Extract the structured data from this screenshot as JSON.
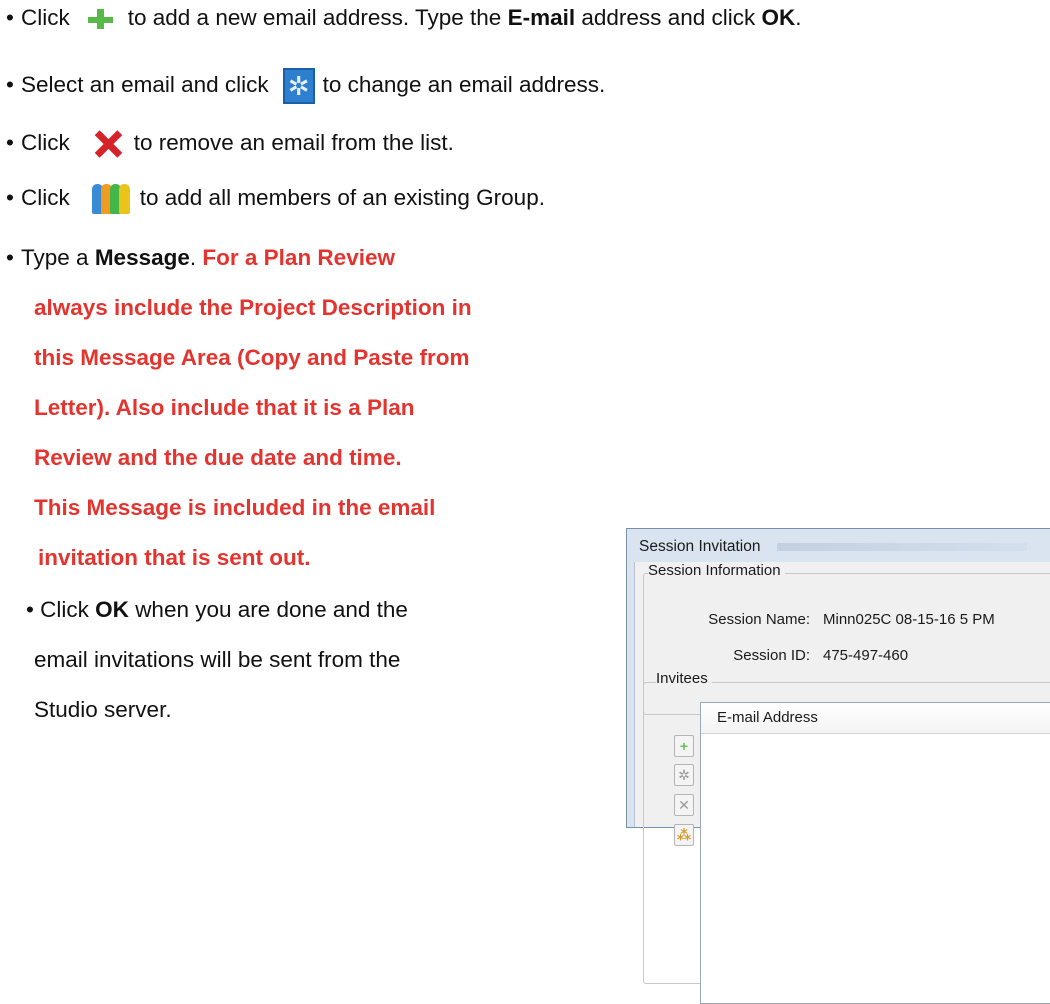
{
  "instructions": {
    "bullet": "•",
    "line1": {
      "text_before": "Click",
      "text_mid": "to add a new email address. Type the",
      "bold1": "E-mail",
      "text_mid2": "address and click",
      "bold2": "OK",
      "text_end": "."
    },
    "line2": {
      "text_before": "Select an email and click",
      "text_after": "to change an email address."
    },
    "line3": {
      "text_before": "Click",
      "text_after": "to remove an email from the list."
    },
    "line4": {
      "text_before": "Click",
      "text_after": "to add all members of an existing Group."
    },
    "line5": {
      "text_before": "Type a",
      "bold": "Message",
      "text_mid": ".",
      "red_first": "For a Plan Review"
    },
    "red_lines": [
      "always include the Project Description in",
      "this Message Area (Copy and Paste from",
      "Letter). Also include that it is a Plan",
      "Review and the due date and time.",
      "This Message is included in the email",
      "invitation that is sent out."
    ],
    "line_ok": {
      "text_before": "Click",
      "bold": "OK",
      "text_after": "when you are done and the"
    },
    "line_ok2": "email invitations will be sent from the",
    "line_ok3": "Studio server."
  },
  "icons": {
    "plus": "plus-icon",
    "gear": "gear-icon",
    "remove": "x-icon",
    "group": "group-icon"
  },
  "dialog": {
    "title": "Session Invitation",
    "session_info_label": "Session Information",
    "session_name_label": "Session Name:",
    "session_name_value": "Minn025C 08-15-16 5 PM",
    "session_id_label": "Session ID:",
    "session_id_value": "475-497-460",
    "invitees_label": "Invitees",
    "list_header": "E-mail Address",
    "side_buttons": [
      "add",
      "edit",
      "remove",
      "group"
    ]
  },
  "colors": {
    "highlight_text": "#e3342f",
    "plus_green": "#57b947",
    "gear_blue": "#2f7fd0",
    "remove_red": "#d6232a"
  }
}
